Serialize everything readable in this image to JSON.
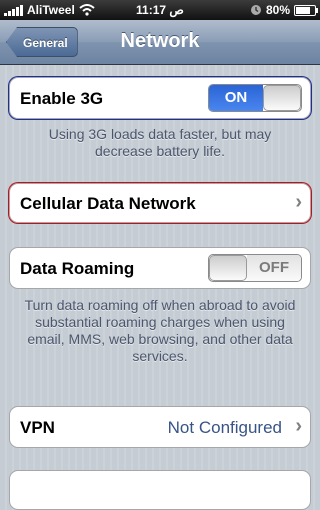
{
  "status_bar": {
    "carrier": "AliTweel",
    "time": "11:17 ص",
    "battery_percent": "80%",
    "battery_level": 0.8,
    "icons": [
      "signal-icon",
      "wifi-icon",
      "lock-icon",
      "battery-icon"
    ]
  },
  "nav": {
    "back_label": "General",
    "title": "Network"
  },
  "enable_3g": {
    "label": "Enable 3G",
    "state": "ON",
    "footnote": "Using 3G loads data faster, but may decrease battery life."
  },
  "cellular": {
    "label": "Cellular Data Network"
  },
  "roaming": {
    "label": "Data Roaming",
    "state": "OFF",
    "footnote": "Turn data roaming off when abroad to avoid substantial roaming charges when using email, MMS, web browsing, and other data services."
  },
  "vpn": {
    "label": "VPN",
    "value": "Not Configured"
  },
  "colors": {
    "switch_on": "#2a64d6",
    "nav_bar": "#6d84a2",
    "value_text": "#385487",
    "focus_3g": "#1f2e9b",
    "focus_cellular": "#c1121a"
  }
}
